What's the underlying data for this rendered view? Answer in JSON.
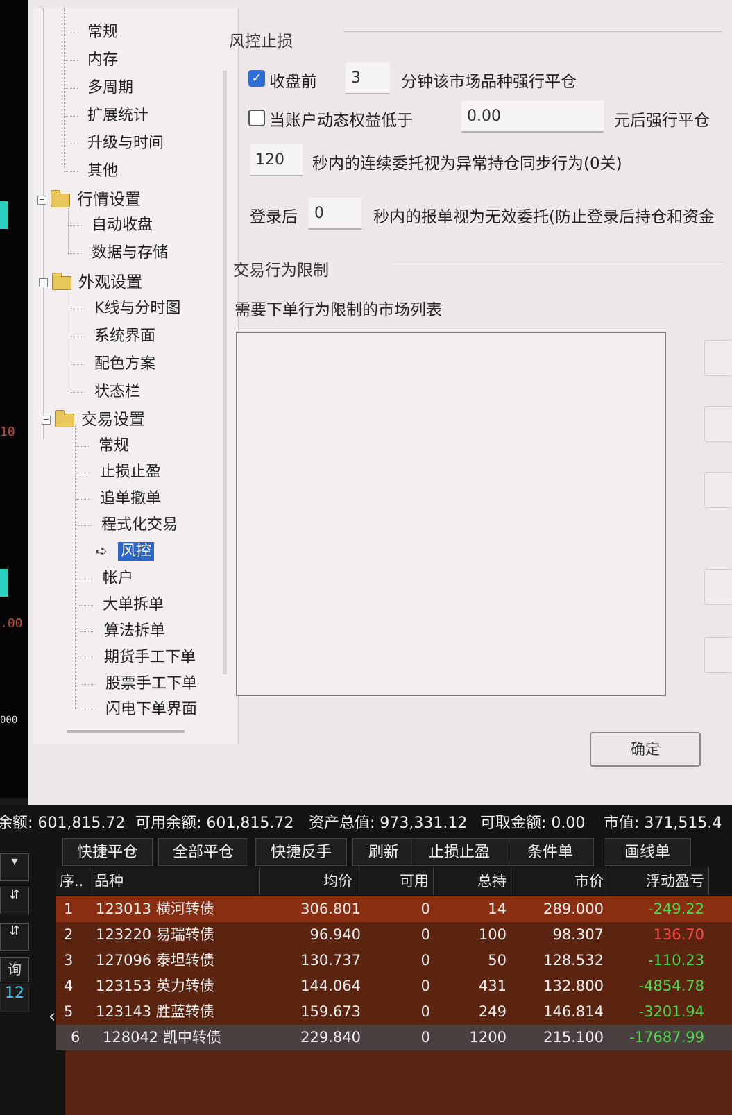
{
  "left_chart": {
    "tick1": "10",
    "tick2": ".00",
    "tick3": "000"
  },
  "tree": {
    "top_items": [
      "常规",
      "内存",
      "多周期",
      "扩展统计",
      "升级与时间",
      "其他"
    ],
    "groups": [
      {
        "label": "行情设置",
        "items": [
          "自动收盘",
          "数据与存储"
        ]
      },
      {
        "label": "外观设置",
        "items": [
          "K线与分时图",
          "系统界面",
          "配色方案",
          "状态栏"
        ]
      },
      {
        "label": "交易设置",
        "items": [
          "常规",
          "止损止盈",
          "追单撤单",
          "程式化交易",
          "风控",
          "帐户",
          "大单拆单",
          "算法拆单",
          "期货手工下单",
          "股票手工下单",
          "闪电下单界面"
        ]
      }
    ],
    "selected": "风控"
  },
  "risk": {
    "section_title": "风控止损",
    "close_before_label": "收盘前",
    "close_before_value": "3",
    "close_before_suffix": "分钟该市场品种强行平仓",
    "equity_label": "当账户动态权益低于",
    "equity_value": "0.00",
    "equity_suffix": "元后强行平仓",
    "seconds_value": "120",
    "seconds_suffix": "秒内的连续委托视为异常持仓同步行为(0关)",
    "login_label": "登录后",
    "login_value": "0",
    "login_suffix": "秒内的报单视为无效委托(防止登录后持仓和资金"
  },
  "trade_limit": {
    "section_title": "交易行为限制",
    "list_label": "需要下单行为限制的市场列表"
  },
  "ok_button": "确定",
  "summary": {
    "balance": "余额: 601,815.72",
    "available": "可用余额: 601,815.72",
    "total_assets": "资产总值: 973,331.12",
    "withdrawable": "可取金额: 0.00",
    "market_value": "市值: 371,515.4"
  },
  "toolbar": [
    "快捷平仓",
    "全部平仓",
    "快捷反手",
    "刷新",
    "止损止盈",
    "条件单",
    "画线单"
  ],
  "left_controls": {
    "query": "询",
    "num": "12"
  },
  "table": {
    "headers": [
      "序..",
      "品种",
      "均价",
      "可用",
      "总持",
      "市价",
      "浮动盈亏"
    ],
    "rows": [
      {
        "idx": "1",
        "name": "123013 横河转债",
        "avg": "306.801",
        "avail": "0",
        "total": "14",
        "price": "289.000",
        "pnl": "-249.22"
      },
      {
        "idx": "2",
        "name": "123220 易瑞转债",
        "avg": "96.940",
        "avail": "0",
        "total": "100",
        "price": "98.307",
        "pnl": "136.70"
      },
      {
        "idx": "3",
        "name": "127096 泰坦转债",
        "avg": "130.737",
        "avail": "0",
        "total": "50",
        "price": "128.532",
        "pnl": "-110.23"
      },
      {
        "idx": "4",
        "name": "123153 英力转债",
        "avg": "144.064",
        "avail": "0",
        "total": "431",
        "price": "132.800",
        "pnl": "-4854.78"
      },
      {
        "idx": "5",
        "name": "123143 胜蓝转债",
        "avg": "159.673",
        "avail": "0",
        "total": "249",
        "price": "146.814",
        "pnl": "-3201.94"
      },
      {
        "idx": "6",
        "name": "128042 凯中转债",
        "avg": "229.840",
        "avail": "0",
        "total": "1200",
        "price": "215.100",
        "pnl": "-17687.99"
      }
    ]
  },
  "colors": {
    "profit": "#ff4a4a",
    "loss": "#4cdc4c",
    "row_bg": "#5b2410",
    "selected_tree": "#2a67c9"
  }
}
